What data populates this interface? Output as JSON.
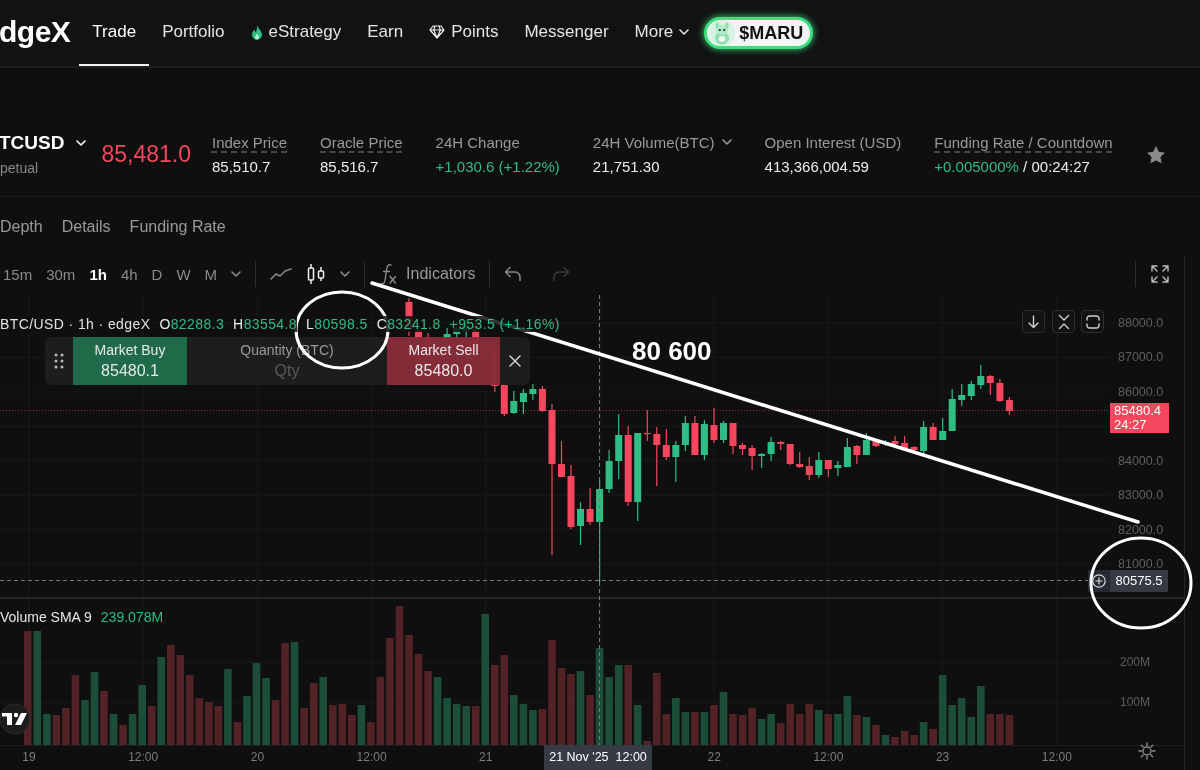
{
  "nav": {
    "logo": "dgeX",
    "items": [
      {
        "label": "Trade",
        "kind": "link",
        "selected": true
      },
      {
        "label": "Portfolio",
        "kind": "link",
        "selected": false
      },
      {
        "label": "eStrategy",
        "kind": "link",
        "selected": false
      },
      {
        "label": "Earn",
        "kind": "link",
        "selected": false
      },
      {
        "label": "Points",
        "kind": "link",
        "selected": false
      },
      {
        "label": "Messenger",
        "kind": "link",
        "selected": false
      },
      {
        "label": "More",
        "kind": "menu",
        "selected": false
      }
    ],
    "token_button": {
      "label": "$MARU"
    }
  },
  "ticker": {
    "symbol": "TCUSD",
    "contract_type": "petual",
    "last_price": "85,481.0",
    "rising": false,
    "starred": false,
    "stats": [
      {
        "label": "Index Price",
        "value": "85,510.7",
        "underlined": true,
        "dropdown": false,
        "positive": false
      },
      {
        "label": "Oracle Price",
        "value": "85,516.7",
        "underlined": true,
        "dropdown": false,
        "positive": false
      },
      {
        "label": "24H Change",
        "value": "+1,030.6 (+1.22%)",
        "underlined": false,
        "dropdown": false,
        "positive": true
      },
      {
        "label": "24H Volume(BTC)",
        "value": "21,751.30",
        "underlined": false,
        "dropdown": true,
        "positive": false
      },
      {
        "label": "Open Interest (USD)",
        "value": "413,366,004.59",
        "underlined": false,
        "dropdown": false,
        "positive": false
      },
      {
        "label": "Funding Rate / Countdown",
        "value": "+0.005000%",
        "countdown": "/ 00:24:27",
        "underlined": true,
        "dropdown": false,
        "positive": true
      }
    ]
  },
  "chart_tabs": [
    {
      "label": "Depth",
      "selected": false
    },
    {
      "label": "Details",
      "selected": false
    },
    {
      "label": "Funding Rate",
      "selected": false
    }
  ],
  "toolbar": {
    "intervals": [
      {
        "label": "15m",
        "selected": false
      },
      {
        "label": "30m",
        "selected": false
      },
      {
        "label": "1h",
        "selected": true
      },
      {
        "label": "4h",
        "selected": false
      },
      {
        "label": "D",
        "selected": false
      },
      {
        "label": "W",
        "selected": false
      },
      {
        "label": "M",
        "selected": false
      }
    ],
    "chart_types": [
      {
        "kind": "line",
        "selected": false
      },
      {
        "kind": "candles",
        "selected": true
      }
    ],
    "indicators": "Indicators",
    "history": [
      {
        "kind": "undo",
        "disabled": false
      },
      {
        "kind": "redo",
        "disabled": true
      }
    ]
  },
  "chart": {
    "legend": {
      "title": "BTC/USD · 1h · edgeX",
      "ohlc": [
        {
          "key": "O",
          "value": "82288.3"
        },
        {
          "key": "H",
          "value": "83554.8"
        },
        {
          "key": "L",
          "value": "80598.5"
        },
        {
          "key": "C",
          "value": "83241.8"
        }
      ],
      "change": "+953.5 (+1.16%)",
      "positive": true
    },
    "order_ticket": {
      "buy": {
        "label": "Market Buy",
        "price": "85480.1"
      },
      "quantity": {
        "label": "Quantity (BTC)",
        "placeholder": "Qty"
      },
      "sell": {
        "label": "Market Sell",
        "price": "85480.0"
      }
    },
    "price_ticks": [
      "88000.0",
      "87000.0",
      "86000.0",
      "84000.0",
      "83000.0",
      "82000.0",
      "81000.0"
    ],
    "last_price_tag": {
      "price": "85480.4",
      "countdown": "24:27"
    },
    "crosshair": {
      "price": "80575.5",
      "time": "21 Nov '25  12:00"
    },
    "annotation": {
      "text": "80 600"
    },
    "volume": {
      "title": "Volume SMA 9",
      "value": "239.078M",
      "ticks": [
        "200M",
        "100M"
      ]
    },
    "time_ticks": [
      "19",
      "12:00",
      "20",
      "12:00",
      "21",
      "22",
      "12:00",
      "23",
      "12:00"
    ]
  }
}
